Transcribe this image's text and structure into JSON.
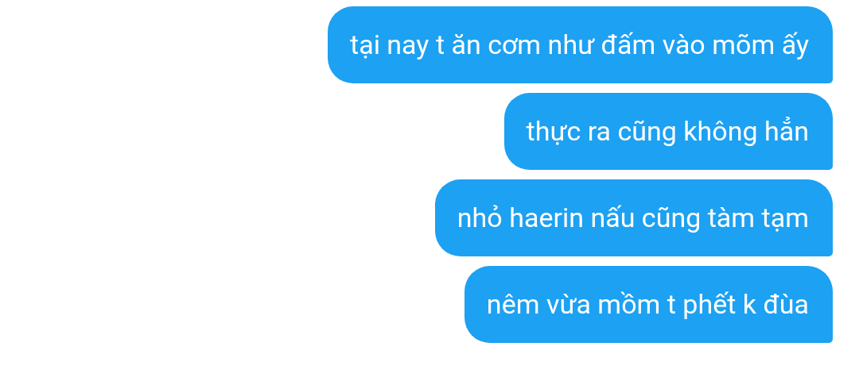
{
  "messages": [
    {
      "text": "tại nay t ăn cơm như đấm vào mõm ấy"
    },
    {
      "text": "thực ra cũng không hẳn"
    },
    {
      "text": "nhỏ haerin nấu cũng tàm tạm"
    },
    {
      "text": "nêm vừa mồm t phết k đùa"
    }
  ]
}
